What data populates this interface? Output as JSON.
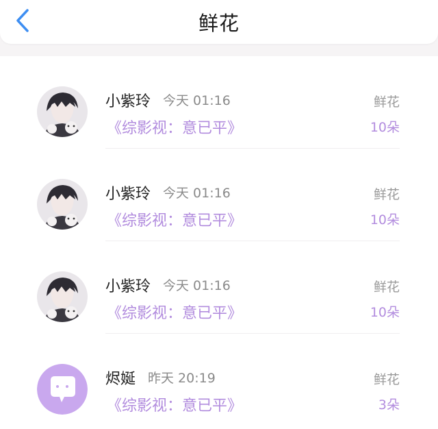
{
  "header": {
    "title": "鲜花"
  },
  "colors": {
    "accent": "#b28cde",
    "back_icon": "#3d8ef2",
    "divider": "#f0eef0"
  },
  "items": [
    {
      "name": "小紫玲",
      "time": "今天 01:16",
      "book": "《综影视：意已平》",
      "gift_type": "鲜花",
      "gift_count": "10朵",
      "avatar_icon": "user-avatar-anime-icon"
    },
    {
      "name": "小紫玲",
      "time": "今天 01:16",
      "book": "《综影视：意已平》",
      "gift_type": "鲜花",
      "gift_count": "10朵",
      "avatar_icon": "user-avatar-anime-icon"
    },
    {
      "name": "小紫玲",
      "time": "今天 01:16",
      "book": "《综影视：意已平》",
      "gift_type": "鲜花",
      "gift_count": "10朵",
      "avatar_icon": "user-avatar-anime-icon"
    },
    {
      "name": "烬娫",
      "time": "昨天 20:19",
      "book": "《综影视：意已平》",
      "gift_type": "鲜花",
      "gift_count": "3朵",
      "avatar_icon": "default-avatar-chat-bubble-icon"
    }
  ]
}
